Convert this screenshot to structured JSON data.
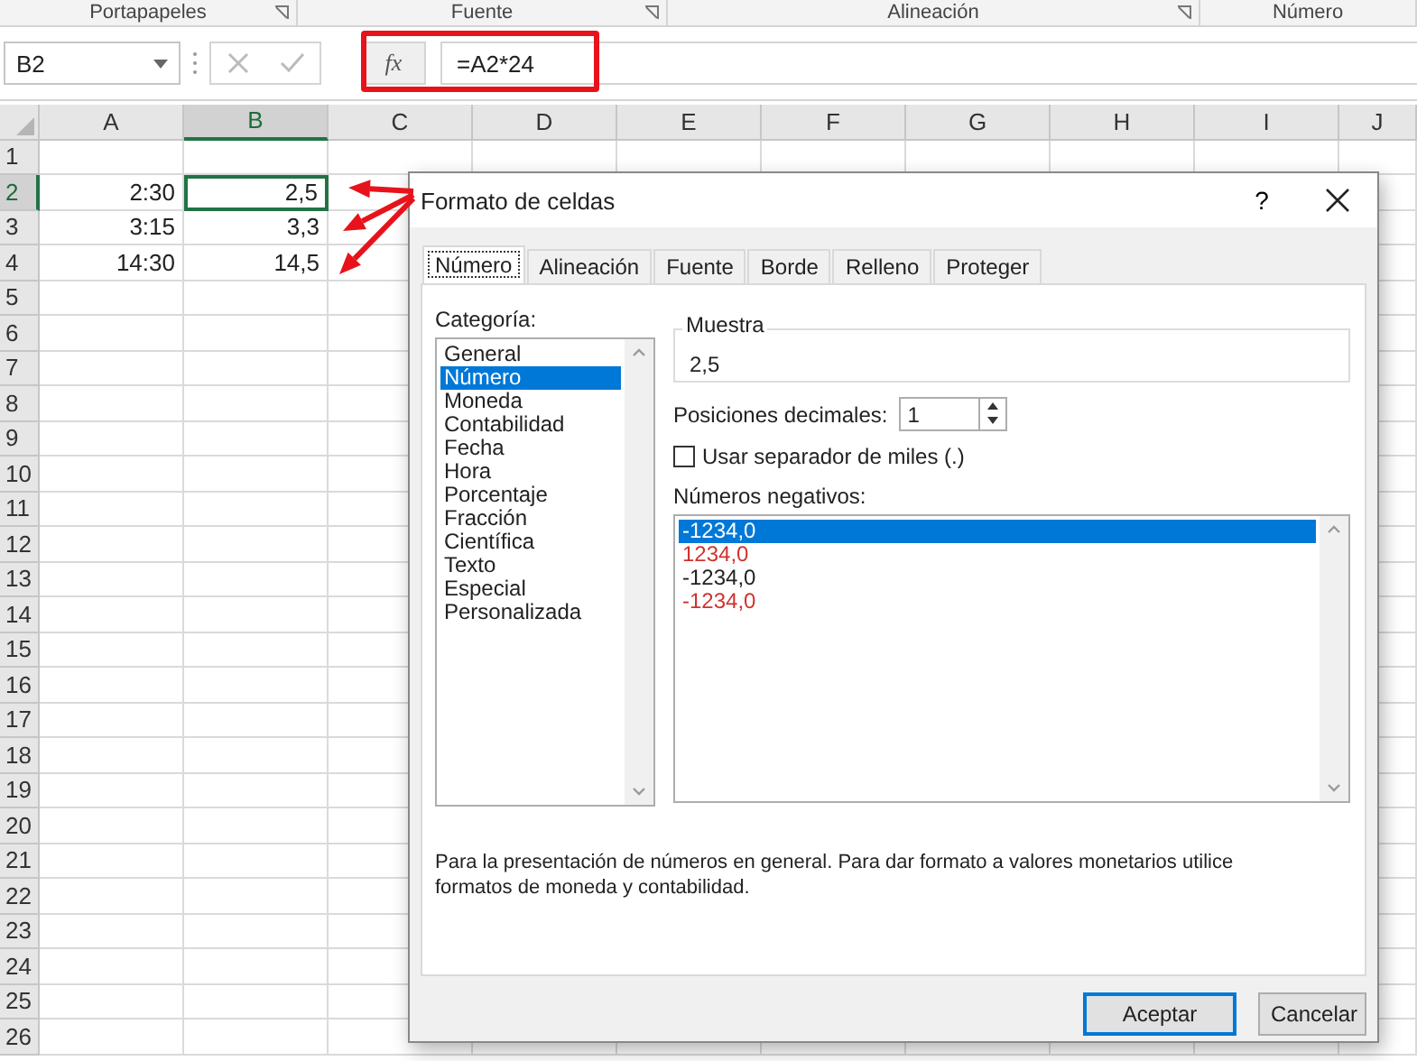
{
  "ribbon_groups": [
    {
      "label": "Portapapeles"
    },
    {
      "label": "Fuente"
    },
    {
      "label": "Alineación"
    },
    {
      "label": "Número"
    }
  ],
  "formula_bar": {
    "name_box": "B2",
    "function_button": "fx",
    "formula": "=A2*24"
  },
  "columns": [
    {
      "label": "A",
      "selected": false
    },
    {
      "label": "B",
      "selected": true
    },
    {
      "label": "C",
      "selected": false
    },
    {
      "label": "D",
      "selected": false
    },
    {
      "label": "E",
      "selected": false
    },
    {
      "label": "F",
      "selected": false
    },
    {
      "label": "G",
      "selected": false
    },
    {
      "label": "H",
      "selected": false
    },
    {
      "label": "I",
      "selected": false
    },
    {
      "label": "J",
      "selected": false
    }
  ],
  "rows": [
    {
      "label": "1",
      "selected": false
    },
    {
      "label": "2",
      "selected": true,
      "cells": [
        {
          "text": "2:30",
          "selected": false
        },
        {
          "text": "2,5",
          "selected": true
        }
      ]
    },
    {
      "label": "3",
      "selected": false,
      "cells": [
        {
          "text": "3:15",
          "selected": false
        },
        {
          "text": "3,3",
          "selected": false
        }
      ]
    },
    {
      "label": "4",
      "selected": false,
      "cells": [
        {
          "text": "14:30",
          "selected": false
        },
        {
          "text": "14,5",
          "selected": false
        }
      ]
    },
    {
      "label": "5",
      "selected": false
    },
    {
      "label": "6",
      "selected": false
    },
    {
      "label": "7",
      "selected": false
    },
    {
      "label": "8",
      "selected": false
    },
    {
      "label": "9",
      "selected": false
    },
    {
      "label": "10",
      "selected": false
    },
    {
      "label": "11",
      "selected": false
    },
    {
      "label": "12",
      "selected": false
    },
    {
      "label": "13",
      "selected": false
    },
    {
      "label": "14",
      "selected": false
    },
    {
      "label": "15",
      "selected": false
    },
    {
      "label": "16",
      "selected": false
    },
    {
      "label": "17",
      "selected": false
    },
    {
      "label": "18",
      "selected": false
    },
    {
      "label": "19",
      "selected": false
    },
    {
      "label": "20",
      "selected": false
    },
    {
      "label": "21",
      "selected": false
    },
    {
      "label": "22",
      "selected": false
    },
    {
      "label": "23",
      "selected": false
    },
    {
      "label": "24",
      "selected": false
    },
    {
      "label": "25",
      "selected": false
    },
    {
      "label": "26",
      "selected": false
    }
  ],
  "dialog": {
    "title": "Formato de celdas",
    "help": "?",
    "tabs": [
      {
        "label": "Número",
        "selected": true
      },
      {
        "label": "Alineación",
        "selected": false
      },
      {
        "label": "Fuente",
        "selected": false
      },
      {
        "label": "Borde",
        "selected": false
      },
      {
        "label": "Relleno",
        "selected": false
      },
      {
        "label": "Proteger",
        "selected": false
      }
    ],
    "category_label": "Categoría:",
    "categories": [
      {
        "label": "General",
        "selected": false
      },
      {
        "label": "Número",
        "selected": true
      },
      {
        "label": "Moneda",
        "selected": false
      },
      {
        "label": "Contabilidad",
        "selected": false
      },
      {
        "label": "Fecha",
        "selected": false
      },
      {
        "label": "Hora",
        "selected": false
      },
      {
        "label": "Porcentaje",
        "selected": false
      },
      {
        "label": "Fracción",
        "selected": false
      },
      {
        "label": "Científica",
        "selected": false
      },
      {
        "label": "Texto",
        "selected": false
      },
      {
        "label": "Especial",
        "selected": false
      },
      {
        "label": "Personalizada",
        "selected": false
      }
    ],
    "sample_label": "Muestra",
    "sample_value": "2,5",
    "decimals_label": "Posiciones decimales:",
    "decimals_value": "1",
    "thousands_separator": {
      "label": "Usar separador de miles (.)",
      "checked": false
    },
    "negatives_label": "Números negativos:",
    "negatives": [
      {
        "text": "-1234,0",
        "kind": "plain",
        "selected": true
      },
      {
        "text": "1234,0",
        "kind": "red",
        "selected": false
      },
      {
        "text": "-1234,0",
        "kind": "plain",
        "selected": false
      },
      {
        "text": "-1234,0",
        "kind": "red",
        "selected": false
      }
    ],
    "description": "Para la presentación de números en general. Para dar formato a valores monetarios utilice formatos de moneda y contabilidad.",
    "buttons": [
      {
        "label": "Aceptar",
        "kind": "default"
      },
      {
        "label": "Cancelar",
        "kind": "normal"
      }
    ]
  }
}
